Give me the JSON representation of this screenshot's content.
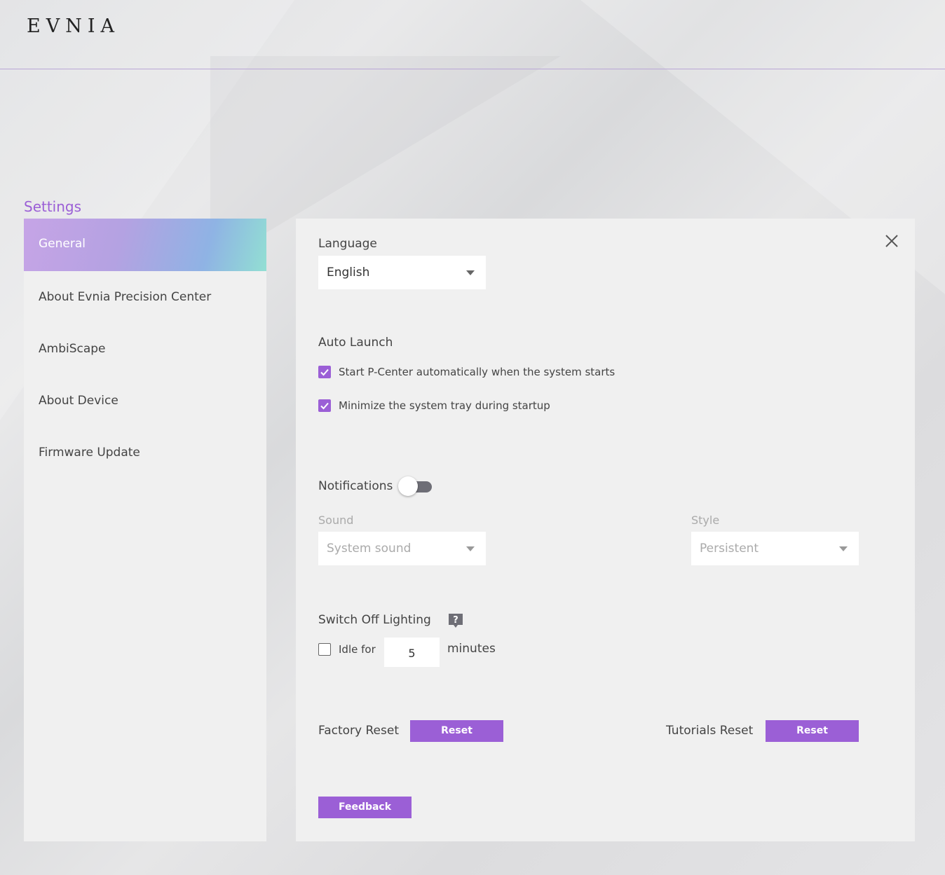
{
  "brand": {
    "logo_text": "EVNIA"
  },
  "page": {
    "title": "Settings"
  },
  "sidebar": {
    "items": [
      {
        "label": "General"
      },
      {
        "label": "About Evnia Precision Center"
      },
      {
        "label": "AmbiScape"
      },
      {
        "label": "About Device"
      },
      {
        "label": "Firmware Update"
      }
    ],
    "active_index": 0
  },
  "general": {
    "language": {
      "label": "Language",
      "value": "English"
    },
    "auto_launch": {
      "label": "Auto Launch",
      "options": [
        {
          "label": "Start P-Center automatically when the system starts",
          "checked": true
        },
        {
          "label": "Minimize the system tray during startup",
          "checked": true
        }
      ]
    },
    "notifications": {
      "label": "Notifications",
      "enabled": false,
      "sound": {
        "label": "Sound",
        "value": "System sound"
      },
      "style": {
        "label": "Style",
        "value": "Persistent"
      }
    },
    "switch_off_lighting": {
      "label": "Switch Off Lighting",
      "idle_label": "Idle for",
      "idle_checked": false,
      "idle_minutes": "5",
      "unit_label": "minutes"
    },
    "factory_reset": {
      "label": "Factory Reset",
      "button_label": "Reset"
    },
    "tutorials_reset": {
      "label": "Tutorials Reset",
      "button_label": "Reset"
    },
    "feedback": {
      "button_label": "Feedback"
    }
  },
  "colors": {
    "accent": "#9b5fd6",
    "panel_bg": "#f0f0f0",
    "header_rule": "#b9a6d6"
  }
}
